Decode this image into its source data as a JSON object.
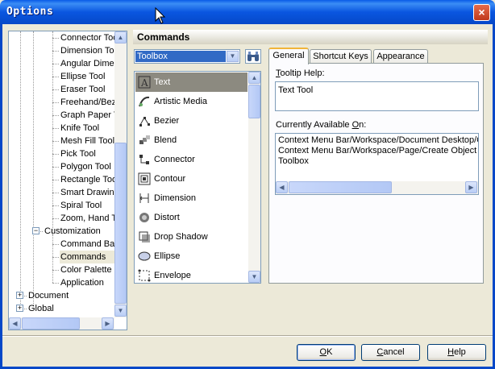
{
  "window": {
    "title": "Options",
    "close_label": "×"
  },
  "tree": {
    "items": [
      {
        "label": "Connector Tool"
      },
      {
        "label": "Dimension Tool"
      },
      {
        "label": "Angular Dimension"
      },
      {
        "label": "Ellipse Tool"
      },
      {
        "label": "Eraser Tool"
      },
      {
        "label": "Freehand/Bezier"
      },
      {
        "label": "Graph Paper Tool"
      },
      {
        "label": "Knife Tool"
      },
      {
        "label": "Mesh Fill Tool"
      },
      {
        "label": "Pick Tool"
      },
      {
        "label": "Polygon Tool"
      },
      {
        "label": "Rectangle Tool"
      },
      {
        "label": "Smart Drawing"
      },
      {
        "label": "Spiral Tool"
      },
      {
        "label": "Zoom, Hand Tool"
      },
      {
        "label": "Customization"
      },
      {
        "label": "Command Bars"
      },
      {
        "label": "Commands"
      },
      {
        "label": "Color Palette"
      },
      {
        "label": "Application"
      },
      {
        "label": "Document"
      },
      {
        "label": "Global"
      }
    ]
  },
  "commands": {
    "header": "Commands",
    "combo_value": "Toolbox",
    "list": [
      {
        "label": "Text"
      },
      {
        "label": "Artistic Media"
      },
      {
        "label": "Bezier"
      },
      {
        "label": "Blend"
      },
      {
        "label": "Connector"
      },
      {
        "label": "Contour"
      },
      {
        "label": "Dimension"
      },
      {
        "label": "Distort"
      },
      {
        "label": "Drop Shadow"
      },
      {
        "label": "Ellipse"
      },
      {
        "label": "Envelope"
      }
    ]
  },
  "tabs": [
    {
      "label": "General"
    },
    {
      "label": "Shortcut Keys"
    },
    {
      "label": "Appearance"
    }
  ],
  "general": {
    "tooltip_label_pre": "T",
    "tooltip_label_post": "ooltip Help:",
    "tooltip_value": "Text Tool",
    "available_label_pre": "Currently Available ",
    "available_label_u": "O",
    "available_label_post": "n:",
    "available_lines": [
      "Context Menu Bar/Workspace/Document Desktop/C",
      "Context Menu Bar/Workspace/Page/Create Object",
      "Toolbox"
    ]
  },
  "buttons": {
    "ok_u": "O",
    "ok_rest": "K",
    "cancel_pre": "C",
    "cancel_rest": "ancel",
    "help_pre": "H",
    "help_rest": "elp"
  },
  "colors": {
    "titlebar": "#0a56e0",
    "selection": "#316ac5",
    "tab_accent": "#f1b53a"
  }
}
